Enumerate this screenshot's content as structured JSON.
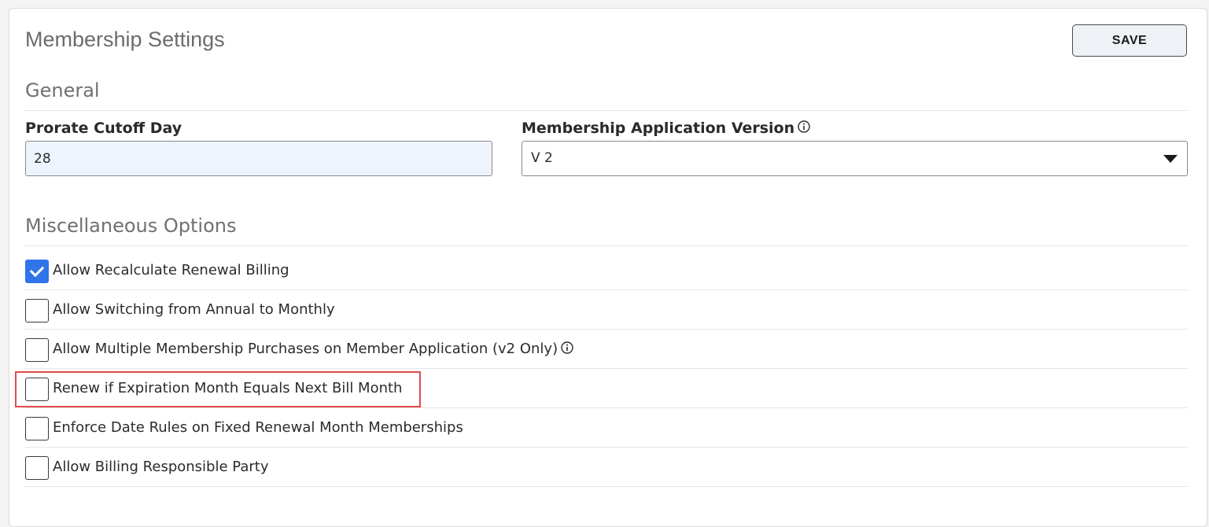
{
  "page": {
    "title": "Membership Settings",
    "save_label": "SAVE"
  },
  "general": {
    "section_title": "General",
    "prorate_label": "Prorate Cutoff Day",
    "prorate_value": "28",
    "app_version_label": "Membership Application Version",
    "app_version_value": "V 2"
  },
  "misc": {
    "section_title": "Miscellaneous Options",
    "options": [
      {
        "label": "Allow Recalculate Renewal Billing",
        "checked": true
      },
      {
        "label": "Allow Switching from Annual to Monthly",
        "checked": false
      },
      {
        "label": "Allow Multiple Membership Purchases on Member Application (v2 Only)",
        "checked": false,
        "info": true
      },
      {
        "label": "Renew if Expiration Month Equals Next Bill Month",
        "checked": false,
        "highlighted": true
      },
      {
        "label": "Enforce Date Rules on Fixed Renewal Month Memberships",
        "checked": false
      },
      {
        "label": "Allow Billing Responsible Party",
        "checked": false
      }
    ]
  },
  "colors": {
    "accent": "#2f74e8",
    "highlight": "#e24a4a"
  },
  "icons": {
    "info": "info-circle-icon",
    "caret": "caret-down-icon",
    "check": "checkmark-icon"
  }
}
